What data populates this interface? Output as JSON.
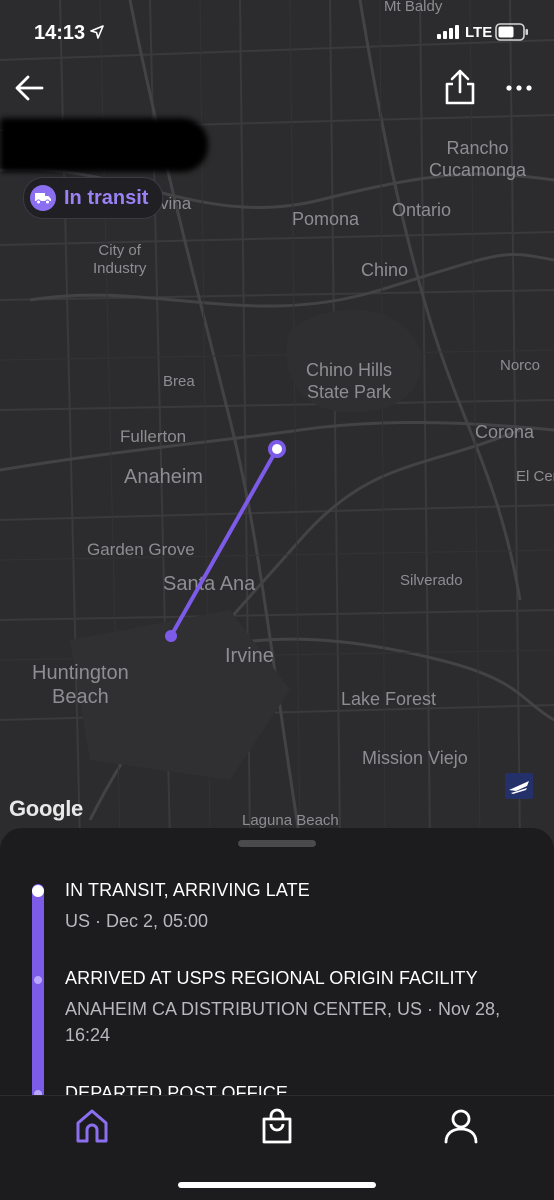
{
  "status_bar": {
    "time": "14:13",
    "network": "LTE"
  },
  "header": {
    "back_icon": "arrow-left-icon",
    "share_icon": "share-icon",
    "more_icon": "ellipsis-icon"
  },
  "badge": {
    "label": "In transit",
    "icon": "truck-icon",
    "color": "#8c6ff0"
  },
  "map": {
    "attribution": "Google",
    "route_color": "#7c5be8",
    "labels": {
      "mt_baldy": "Mt Baldy",
      "rancho": "Rancho\nCucamonga",
      "vina": "vina",
      "pomona": "Pomona",
      "ontario": "Ontario",
      "city_of_industry": "City of\nIndustry",
      "chino": "Chino",
      "brea": "Brea",
      "chino_hills": "Chino Hills\nState Park",
      "norco": "Norco",
      "fullerton": "Fullerton",
      "corona": "Corona",
      "anaheim": "Anaheim",
      "el_cerrito": "El Cer",
      "garden_grove": "Garden Grove",
      "santa_ana": "Santa Ana",
      "silverado": "Silverado",
      "huntington": "Huntington\nBeach",
      "irvine": "Irvine",
      "lake_forest": "Lake Forest",
      "mission_viejo": "Mission Viejo",
      "laguna_beach": "Laguna Beach"
    }
  },
  "tracking": {
    "events": [
      {
        "title": "IN TRANSIT, ARRIVING LATE",
        "subtitle": "US · Dec 2, 05:00"
      },
      {
        "title": "ARRIVED AT USPS REGIONAL ORIGIN FACILITY",
        "subtitle": "ANAHEIM CA DISTRIBUTION CENTER, US · Nov 28, 16:24"
      },
      {
        "title": "DEPARTED POST OFFICE",
        "subtitle": ""
      }
    ]
  },
  "tabbar": {
    "tabs": [
      {
        "name": "home",
        "icon": "home-icon",
        "active": true
      },
      {
        "name": "shop",
        "icon": "shopping-bag-icon",
        "active": false
      },
      {
        "name": "profile",
        "icon": "user-icon",
        "active": false
      }
    ],
    "active_color": "#8c6ff0"
  }
}
